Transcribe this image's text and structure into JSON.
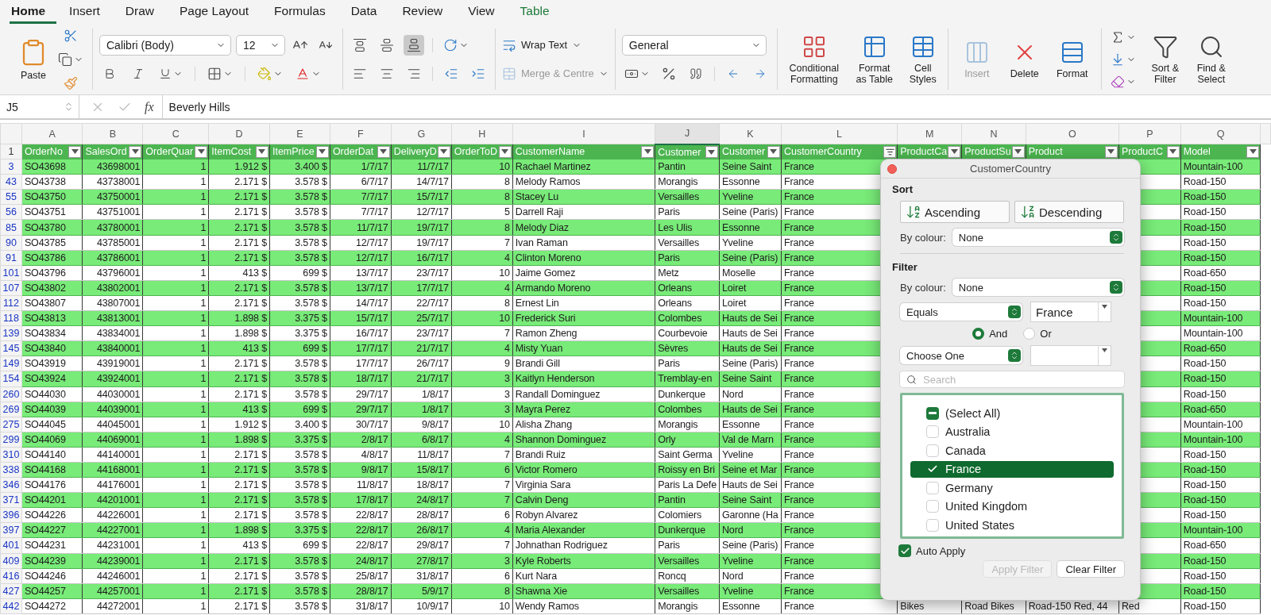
{
  "tabs": [
    {
      "label": "Home",
      "selected": true,
      "contextual": false
    },
    {
      "label": "Insert",
      "selected": false,
      "contextual": false
    },
    {
      "label": "Draw",
      "selected": false,
      "contextual": false
    },
    {
      "label": "Page Layout",
      "selected": false,
      "contextual": false
    },
    {
      "label": "Formulas",
      "selected": false,
      "contextual": false
    },
    {
      "label": "Data",
      "selected": false,
      "contextual": false
    },
    {
      "label": "Review",
      "selected": false,
      "contextual": false
    },
    {
      "label": "View",
      "selected": false,
      "contextual": false
    },
    {
      "label": "Table",
      "selected": false,
      "contextual": true
    }
  ],
  "ribbon": {
    "paste": "Paste",
    "font": "Calibri (Body)",
    "size": "12",
    "valign": [
      {
        "selected": false
      },
      {
        "selected": false
      },
      {
        "selected": true
      }
    ],
    "wrap": "Wrap Text",
    "merge": {
      "label": "Merge & Centre",
      "disabled": true
    },
    "number_format": "General",
    "styles": [
      "Conditional Formatting",
      "Format as Table",
      "Cell Styles"
    ],
    "cells": [
      {
        "label": "Insert",
        "disabled": true
      },
      {
        "label": "Delete",
        "disabled": false
      },
      {
        "label": "Format",
        "disabled": false
      }
    ],
    "editing": [
      "Sort & Filter",
      "Find & Select"
    ]
  },
  "formula_bar": {
    "name_box": "J5",
    "fx": "fx",
    "value": "Beverly Hills"
  },
  "sheet": {
    "columns": [
      {
        "letter": "A",
        "selected": false
      },
      {
        "letter": "B",
        "selected": false
      },
      {
        "letter": "C",
        "selected": false
      },
      {
        "letter": "D",
        "selected": false
      },
      {
        "letter": "E",
        "selected": false
      },
      {
        "letter": "F",
        "selected": false
      },
      {
        "letter": "G",
        "selected": false
      },
      {
        "letter": "H",
        "selected": false
      },
      {
        "letter": "I",
        "selected": false
      },
      {
        "letter": "J",
        "selected": true
      },
      {
        "letter": "K",
        "selected": false
      },
      {
        "letter": "L",
        "selected": false
      },
      {
        "letter": "M",
        "selected": false
      },
      {
        "letter": "N",
        "selected": false
      },
      {
        "letter": "O",
        "selected": false
      },
      {
        "letter": "P",
        "selected": false
      },
      {
        "letter": "Q",
        "selected": false
      }
    ],
    "header_row": "1",
    "headers": [
      {
        "label": "OrderNo",
        "filtered": false
      },
      {
        "label": "SalesOrd",
        "filtered": false
      },
      {
        "label": "OrderQuar",
        "filtered": false
      },
      {
        "label": "ItemCost",
        "filtered": false
      },
      {
        "label": "ItemPrice",
        "filtered": false
      },
      {
        "label": "OrderDat",
        "filtered": false
      },
      {
        "label": "DeliveryD",
        "filtered": false
      },
      {
        "label": "OrderToD",
        "filtered": false
      },
      {
        "label": "CustomerName",
        "filtered": false
      },
      {
        "label": "Customer",
        "filtered": false
      },
      {
        "label": "Customer",
        "filtered": false
      },
      {
        "label": "CustomerCountry",
        "filtered": true
      },
      {
        "label": "ProductCa",
        "filtered": false
      },
      {
        "label": "ProductSu",
        "filtered": false
      },
      {
        "label": "Product",
        "filtered": false
      },
      {
        "label": "ProductC",
        "filtered": false
      },
      {
        "label": "Model",
        "filtered": false
      }
    ],
    "rows": [
      {
        "n": "3",
        "cells": [
          "SO43698",
          "43698001",
          "1",
          "1.912 $",
          "3.400 $",
          "1/7/17",
          "11/7/17",
          "10",
          "Rachael Martinez",
          "Pantin",
          "Seine Saint",
          "France"
        ],
        "model": "Mountain-100"
      },
      {
        "n": "43",
        "cells": [
          "SO43738",
          "43738001",
          "1",
          "2.171 $",
          "3.578 $",
          "6/7/17",
          "14/7/17",
          "8",
          "Melody Ramos",
          "Morangis",
          "Essonne",
          "France"
        ],
        "model": "Road-150"
      },
      {
        "n": "55",
        "cells": [
          "SO43750",
          "43750001",
          "1",
          "2.171 $",
          "3.578 $",
          "7/7/17",
          "15/7/17",
          "8",
          "Stacey Lu",
          "Versailles",
          "Yveline",
          "France"
        ],
        "model": "Road-150"
      },
      {
        "n": "56",
        "cells": [
          "SO43751",
          "43751001",
          "1",
          "2.171 $",
          "3.578 $",
          "7/7/17",
          "12/7/17",
          "5",
          "Darrell Raji",
          "Paris",
          "Seine (Paris)",
          "France"
        ],
        "model": "Road-150"
      },
      {
        "n": "85",
        "cells": [
          "SO43780",
          "43780001",
          "1",
          "2.171 $",
          "3.578 $",
          "11/7/17",
          "19/7/17",
          "8",
          "Melody Diaz",
          "Les Ulis",
          "Essonne",
          "France"
        ],
        "model": "Road-150"
      },
      {
        "n": "90",
        "cells": [
          "SO43785",
          "43785001",
          "1",
          "2.171 $",
          "3.578 $",
          "12/7/17",
          "19/7/17",
          "7",
          "Ivan Raman",
          "Versailles",
          "Yveline",
          "France"
        ],
        "model": "Road-150"
      },
      {
        "n": "91",
        "cells": [
          "SO43786",
          "43786001",
          "1",
          "2.171 $",
          "3.578 $",
          "12/7/17",
          "16/7/17",
          "4",
          "Clinton Moreno",
          "Paris",
          "Seine (Paris)",
          "France"
        ],
        "model": "Road-150"
      },
      {
        "n": "101",
        "cells": [
          "SO43796",
          "43796001",
          "1",
          "413 $",
          "699 $",
          "13/7/17",
          "23/7/17",
          "10",
          "Jaime Gomez",
          "Metz",
          "Moselle",
          "France"
        ],
        "model": "Road-650"
      },
      {
        "n": "107",
        "cells": [
          "SO43802",
          "43802001",
          "1",
          "2.171 $",
          "3.578 $",
          "13/7/17",
          "17/7/17",
          "4",
          "Armando Moreno",
          "Orleans",
          "Loiret",
          "France"
        ],
        "model": "Road-150"
      },
      {
        "n": "112",
        "cells": [
          "SO43807",
          "43807001",
          "1",
          "2.171 $",
          "3.578 $",
          "14/7/17",
          "22/7/17",
          "8",
          "Ernest Lin",
          "Orleans",
          "Loiret",
          "France"
        ],
        "model": "Road-150"
      },
      {
        "n": "118",
        "cells": [
          "SO43813",
          "43813001",
          "1",
          "1.898 $",
          "3.375 $",
          "15/7/17",
          "25/7/17",
          "10",
          "Frederick Suri",
          "Colombes",
          "Hauts de Sei",
          "France"
        ],
        "model": "Mountain-100"
      },
      {
        "n": "139",
        "cells": [
          "SO43834",
          "43834001",
          "1",
          "1.898 $",
          "3.375 $",
          "16/7/17",
          "23/7/17",
          "7",
          "Ramon Zheng",
          "Courbevoie",
          "Hauts de Sei",
          "France"
        ],
        "model": "Mountain-100"
      },
      {
        "n": "145",
        "cells": [
          "SO43840",
          "43840001",
          "1",
          "413 $",
          "699 $",
          "17/7/17",
          "21/7/17",
          "4",
          "Misty Yuan",
          "Sèvres",
          "Hauts de Sei",
          "France"
        ],
        "model": "Road-650"
      },
      {
        "n": "149",
        "cells": [
          "SO43919",
          "43919001",
          "1",
          "2.171 $",
          "3.578 $",
          "17/7/17",
          "26/7/17",
          "9",
          "Brandi Gill",
          "Paris",
          "Seine (Paris)",
          "France"
        ],
        "model": "Road-150"
      },
      {
        "n": "154",
        "cells": [
          "SO43924",
          "43924001",
          "1",
          "2.171 $",
          "3.578 $",
          "18/7/17",
          "21/7/17",
          "3",
          "Kaitlyn Henderson",
          "Tremblay-en",
          "Seine Saint",
          "France"
        ],
        "model": "Road-150"
      },
      {
        "n": "260",
        "cells": [
          "SO44030",
          "44030001",
          "1",
          "2.171 $",
          "3.578 $",
          "29/7/17",
          "1/8/17",
          "3",
          "Randall Dominguez",
          "Dunkerque",
          "Nord",
          "France"
        ],
        "model": "Road-150"
      },
      {
        "n": "269",
        "cells": [
          "SO44039",
          "44039001",
          "1",
          "413 $",
          "699 $",
          "29/7/17",
          "1/8/17",
          "3",
          "Mayra Perez",
          "Colombes",
          "Hauts de Sei",
          "France"
        ],
        "model": "Road-650"
      },
      {
        "n": "275",
        "cells": [
          "SO44045",
          "44045001",
          "1",
          "1.912 $",
          "3.400 $",
          "30/7/17",
          "9/8/17",
          "10",
          "Alisha Zhang",
          "Morangis",
          "Essonne",
          "France"
        ],
        "model": "Mountain-100"
      },
      {
        "n": "299",
        "cells": [
          "SO44069",
          "44069001",
          "1",
          "1.898 $",
          "3.375 $",
          "2/8/17",
          "6/8/17",
          "4",
          "Shannon Dominguez",
          "Orly",
          "Val de Marn",
          "France"
        ],
        "model": "Mountain-100"
      },
      {
        "n": "310",
        "cells": [
          "SO44140",
          "44140001",
          "1",
          "2.171 $",
          "3.578 $",
          "4/8/17",
          "11/8/17",
          "7",
          "Brandi Ruiz",
          "Saint Germa",
          "Yveline",
          "France"
        ],
        "model": "Road-150"
      },
      {
        "n": "338",
        "cells": [
          "SO44168",
          "44168001",
          "1",
          "2.171 $",
          "3.578 $",
          "9/8/17",
          "15/8/17",
          "6",
          "Victor Romero",
          "Roissy en Bri",
          "Seine et Mar",
          "France"
        ],
        "model": "Road-150"
      },
      {
        "n": "346",
        "cells": [
          "SO44176",
          "44176001",
          "1",
          "2.171 $",
          "3.578 $",
          "11/8/17",
          "18/8/17",
          "7",
          "Virginia Sara",
          "Paris La Defe",
          "Hauts de Sei",
          "France"
        ],
        "model": "Road-150"
      },
      {
        "n": "371",
        "cells": [
          "SO44201",
          "44201001",
          "1",
          "2.171 $",
          "3.578 $",
          "17/8/17",
          "24/8/17",
          "7",
          "Calvin Deng",
          "Pantin",
          "Seine Saint",
          "France"
        ],
        "model": "Road-150"
      },
      {
        "n": "396",
        "cells": [
          "SO44226",
          "44226001",
          "1",
          "2.171 $",
          "3.578 $",
          "22/8/17",
          "28/8/17",
          "6",
          "Robyn Alvarez",
          "Colomiers",
          "Garonne (Ha",
          "France"
        ],
        "model": "Road-150"
      },
      {
        "n": "397",
        "cells": [
          "SO44227",
          "44227001",
          "1",
          "1.898 $",
          "3.375 $",
          "22/8/17",
          "26/8/17",
          "4",
          "Maria Alexander",
          "Dunkerque",
          "Nord",
          "France"
        ],
        "model": "Mountain-100"
      },
      {
        "n": "401",
        "cells": [
          "SO44231",
          "44231001",
          "1",
          "413 $",
          "699 $",
          "22/8/17",
          "29/8/17",
          "7",
          "Johnathan Rodriguez",
          "Paris",
          "Seine (Paris)",
          "France"
        ],
        "model": "Road-650"
      },
      {
        "n": "409",
        "cells": [
          "SO44239",
          "44239001",
          "1",
          "2.171 $",
          "3.578 $",
          "24/8/17",
          "27/8/17",
          "3",
          "Kyle Roberts",
          "Versailles",
          "Yveline",
          "France"
        ],
        "model": "Road-150"
      },
      {
        "n": "416",
        "cells": [
          "SO44246",
          "44246001",
          "1",
          "2.171 $",
          "3.578 $",
          "25/8/17",
          "31/8/17",
          "6",
          "Kurt Nara",
          "Roncq",
          "Nord",
          "France"
        ],
        "model": "Road-150"
      },
      {
        "n": "427",
        "cells": [
          "SO44257",
          "44257001",
          "1",
          "2.171 $",
          "3.578 $",
          "28/8/17",
          "5/9/17",
          "8",
          "Shawna Xie",
          "Versailles",
          "Yveline",
          "France"
        ],
        "model": "Road-150"
      },
      {
        "n": "442",
        "cells": [
          "SO44272",
          "44272001",
          "1",
          "2.171 $",
          "3.578 $",
          "31/8/17",
          "10/9/17",
          "10",
          "Wendy Ramos",
          "Morangis",
          "Essonne",
          "France"
        ],
        "product_cells": [
          "Bikes",
          "Road Bikes",
          "Road-150 Red, 44",
          "Red"
        ],
        "model": "Road-150"
      }
    ]
  },
  "filter_popup": {
    "title": "CustomerCountry",
    "sort_heading": "Sort",
    "ascending": "Ascending",
    "descending": "Descending",
    "sort_colour_label": "By colour:",
    "sort_colour": "None",
    "filter_heading": "Filter",
    "filter_colour_label": "By colour:",
    "filter_colour": "None",
    "operator": "Equals",
    "operand": "France",
    "logic": [
      {
        "label": "And",
        "selected": true
      },
      {
        "label": "Or",
        "selected": false
      }
    ],
    "operator_2": "Choose One",
    "search": {
      "placeholder": "Search"
    },
    "values": [
      {
        "kind": "select_all",
        "label": "(Select All)",
        "mixed": true,
        "selected": false
      },
      {
        "kind": "value",
        "label": "Australia",
        "checked": false,
        "selected": false
      },
      {
        "kind": "value",
        "label": "Canada",
        "checked": false,
        "selected": false
      },
      {
        "kind": "value",
        "label": "France",
        "checked": true,
        "selected": true
      },
      {
        "kind": "value",
        "label": "Germany",
        "checked": false,
        "selected": false
      },
      {
        "kind": "value",
        "label": "United Kingdom",
        "checked": false,
        "selected": false
      },
      {
        "kind": "value",
        "label": "United States",
        "checked": false,
        "selected": false
      }
    ],
    "auto_apply": {
      "label": "Auto Apply",
      "checked": true
    },
    "buttons": [
      {
        "label": "Apply Filter",
        "disabled": true
      },
      {
        "label": "Clear Filter",
        "disabled": false
      }
    ]
  }
}
